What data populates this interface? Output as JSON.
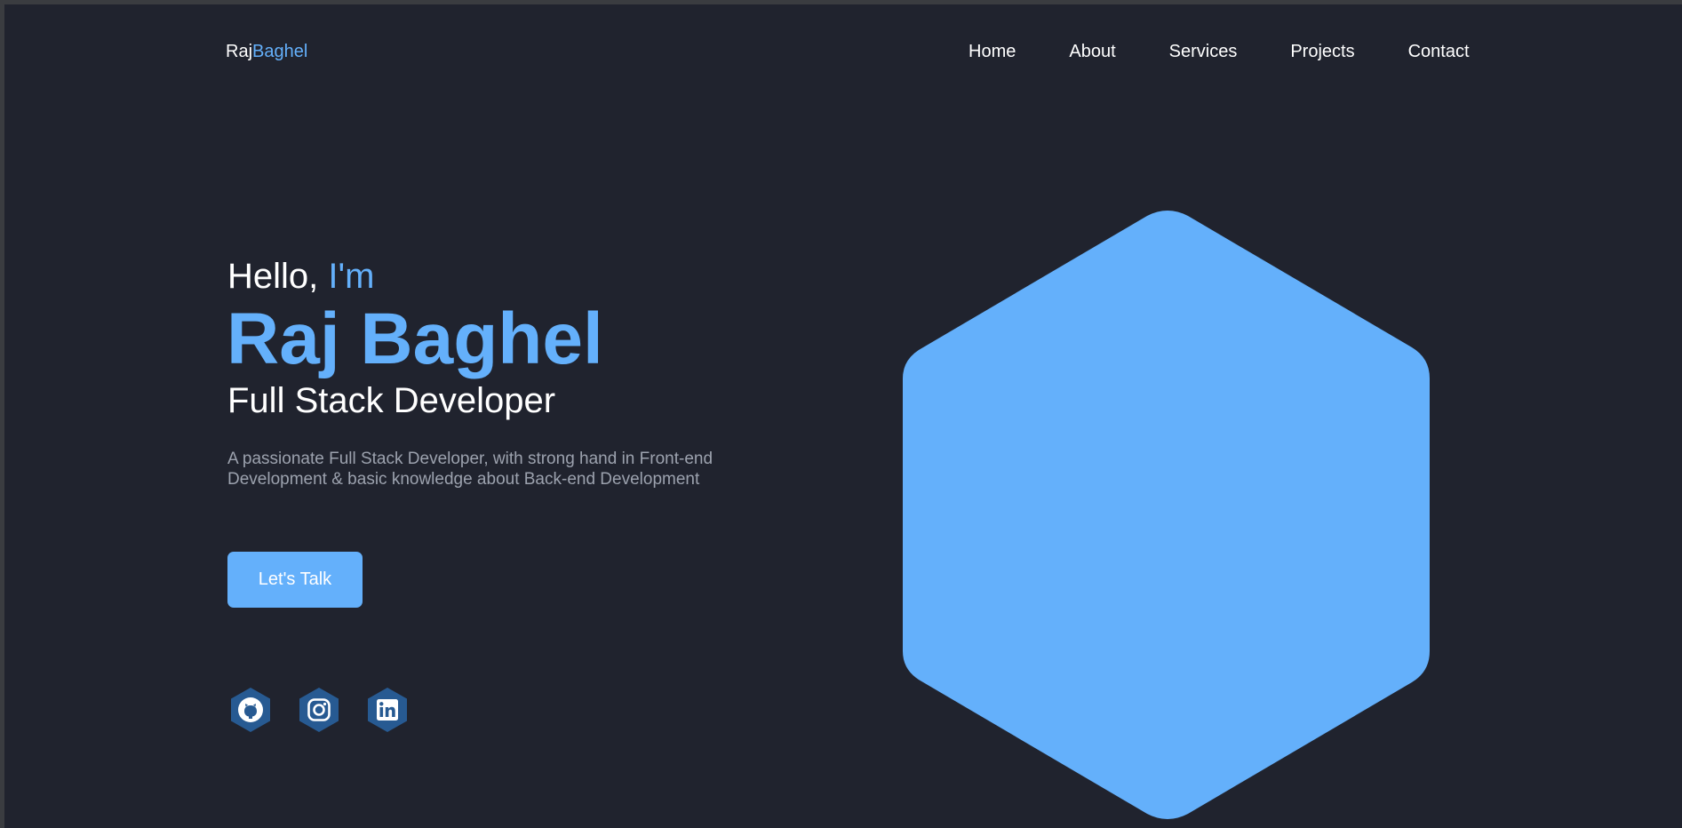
{
  "logo": {
    "part1": "Raj",
    "part2": "Baghel"
  },
  "nav": {
    "items": [
      "Home",
      "About",
      "Services",
      "Projects",
      "Contact"
    ]
  },
  "hero": {
    "hello": "Hello, ",
    "hello_accent": "I'm",
    "name": "Raj Baghel",
    "role": "Full Stack Developer",
    "description": "A passionate Full Stack Developer, with strong hand in Front-end Development & basic knowledge about Back-end Development",
    "cta_label": "Let's Talk"
  },
  "social": {
    "icons": [
      "github-icon",
      "instagram-icon",
      "linkedin-icon"
    ]
  },
  "colors": {
    "background": "#20232e",
    "accent": "#64b0fb",
    "text": "#ffffff",
    "muted": "#9ca2ae",
    "social_bg": "#275a92"
  }
}
